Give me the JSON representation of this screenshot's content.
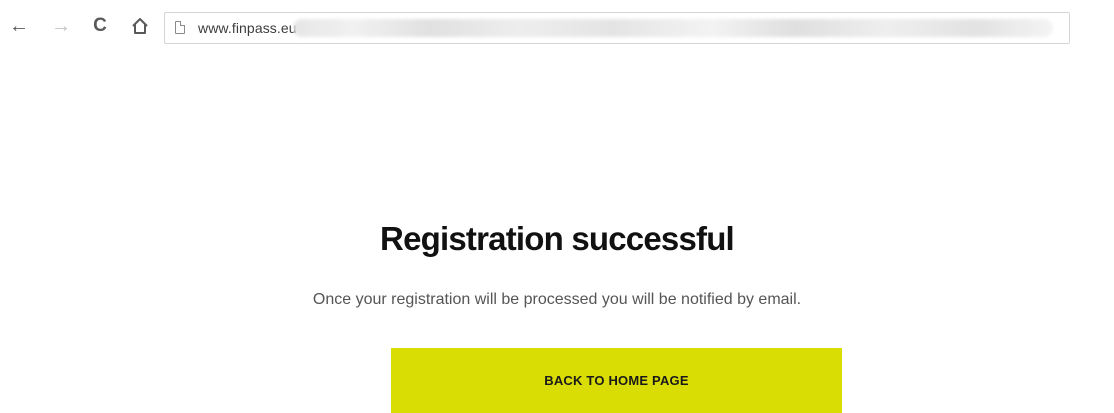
{
  "browser": {
    "nav": {
      "back_glyph": "←",
      "forward_glyph": "→",
      "reload_glyph": "C"
    },
    "address_bar": {
      "url_visible": "www.finpass.eu"
    }
  },
  "page": {
    "title": "Registration successful",
    "message": "Once your registration will be processed you will be notified by email.",
    "button_label": "BACK TO HOME PAGE",
    "accent_color": "#d9dd04"
  }
}
